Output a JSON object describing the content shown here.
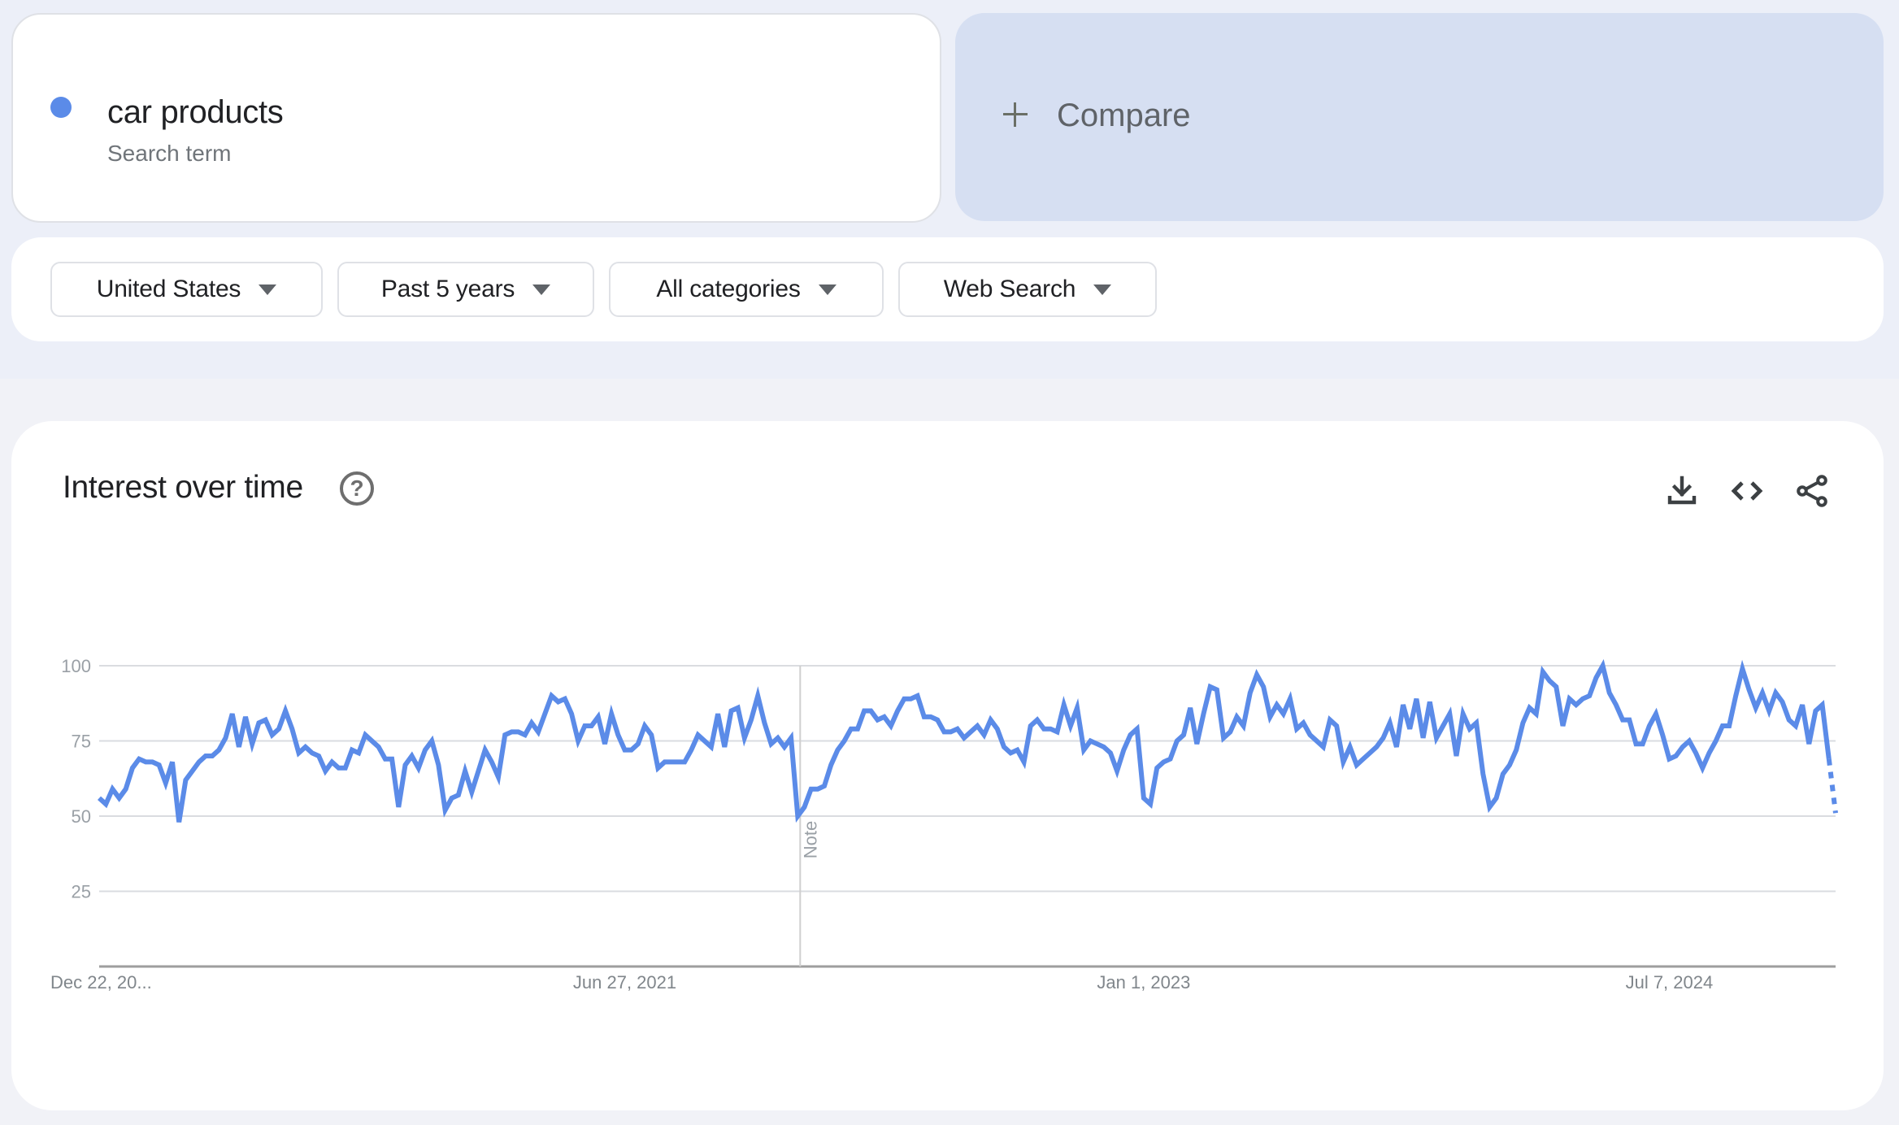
{
  "search_term": {
    "title": "car products",
    "subtitle": "Search term",
    "color": "#5b8be8"
  },
  "compare": {
    "icon": "plus-icon",
    "label": "Compare"
  },
  "filters": [
    {
      "label": "United States",
      "icon": "caret-down-icon"
    },
    {
      "label": "Past 5 years",
      "icon": "caret-down-icon"
    },
    {
      "label": "All categories",
      "icon": "caret-down-icon"
    },
    {
      "label": "Web Search",
      "icon": "caret-down-icon"
    }
  ],
  "chart_panel": {
    "title": "Interest over time",
    "help_icon": "help-circle-icon",
    "help_glyph": "?",
    "actions": [
      "download-icon",
      "embed-code-icon",
      "share-icon"
    ]
  },
  "chart_data": {
    "type": "line",
    "title": "Interest over time",
    "xlabel": "",
    "ylabel": "",
    "ylim": [
      0,
      100
    ],
    "yticks": [
      25,
      50,
      75,
      100
    ],
    "grid": true,
    "x_tick_labels": [
      {
        "label": "Dec 22, 20...",
        "index": 0
      },
      {
        "label": "Jun 27, 2021",
        "index": 79
      },
      {
        "label": "Jan 1, 2023",
        "index": 157
      },
      {
        "label": "Jul 7, 2024",
        "index": 236
      }
    ],
    "annotation": {
      "label": "Note",
      "index": 105
    },
    "series": [
      {
        "name": "car products",
        "color": "#5b8be8",
        "partial_last_point": true,
        "values": [
          56,
          54,
          59,
          56,
          59,
          66,
          69,
          68,
          68,
          67,
          61,
          68,
          48,
          62,
          65,
          68,
          70,
          70,
          72,
          76,
          84,
          73,
          83,
          74,
          81,
          82,
          77,
          79,
          85,
          79,
          71,
          73,
          71,
          70,
          65,
          68,
          66,
          66,
          72,
          71,
          77,
          75,
          73,
          69,
          69,
          53,
          67,
          70,
          66,
          72,
          75,
          67,
          52,
          56,
          57,
          65,
          58,
          65,
          72,
          68,
          63,
          77,
          78,
          78,
          77,
          81,
          78,
          84,
          90,
          88,
          89,
          84,
          75,
          80,
          80,
          83,
          74,
          84,
          77,
          72,
          72,
          74,
          80,
          77,
          66,
          68,
          68,
          68,
          68,
          72,
          77,
          75,
          73,
          84,
          73,
          85,
          86,
          76,
          82,
          90,
          81,
          74,
          76,
          73,
          76,
          50,
          53,
          59,
          59,
          60,
          67,
          72,
          75,
          79,
          79,
          85,
          85,
          82,
          83,
          80,
          85,
          89,
          89,
          90,
          83,
          83,
          82,
          78,
          78,
          79,
          76,
          78,
          80,
          77,
          82,
          79,
          73,
          71,
          72,
          68,
          80,
          82,
          79,
          79,
          78,
          87,
          80,
          86,
          72,
          75,
          74,
          73,
          71,
          65,
          72,
          77,
          79,
          56,
          54,
          66,
          68,
          69,
          75,
          77,
          86,
          74,
          84,
          93,
          92,
          76,
          78,
          83,
          80,
          91,
          97,
          93,
          83,
          87,
          84,
          89,
          79,
          81,
          77,
          75,
          73,
          82,
          80,
          68,
          73,
          67,
          69,
          71,
          73,
          76,
          81,
          73,
          87,
          79,
          89,
          76,
          88,
          76,
          80,
          84,
          70,
          84,
          79,
          81,
          64,
          53,
          56,
          64,
          67,
          72,
          81,
          86,
          84,
          98,
          95,
          93,
          80,
          89,
          87,
          89,
          90,
          96,
          100,
          91,
          87,
          82,
          82,
          74,
          74,
          80,
          84,
          77,
          69,
          70,
          73,
          75,
          71,
          66,
          71,
          75,
          80,
          80,
          90,
          99,
          92,
          86,
          91,
          85,
          91,
          88,
          82,
          80,
          87,
          74,
          85,
          87,
          69,
          51
        ]
      }
    ]
  }
}
